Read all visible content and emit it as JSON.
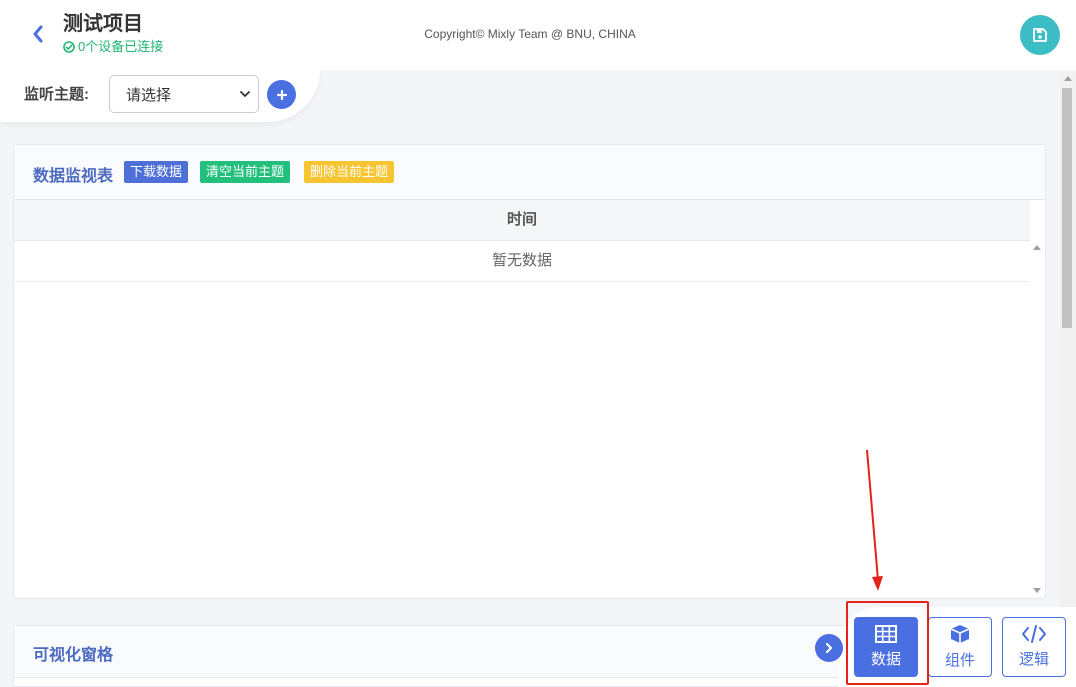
{
  "header": {
    "title": "测试项目",
    "status": "0个设备已连接",
    "copyright": "Copyright© Mixly Team @ BNU, CHINA"
  },
  "topic": {
    "label": "监听主题:",
    "select_value": "请选择"
  },
  "monitor": {
    "title": "数据监视表",
    "actions": {
      "download": "下载数据",
      "clear": "清空当前主题",
      "delete": "删除当前主题"
    },
    "columns": [
      "时间"
    ],
    "empty_text": "暂无数据"
  },
  "grid": {
    "title": "可视化窗格"
  },
  "toolbar": {
    "data_label": "数据",
    "component_label": "组件",
    "logic_label": "逻辑",
    "active": "数据"
  },
  "icons": {
    "back": "chevron-left-icon",
    "status": "check-circle-icon",
    "save": "floppy-disk-icon",
    "add": "plus-icon",
    "toggle": "chevron-right-icon",
    "data": "table-grid-icon",
    "component": "cube-icon",
    "logic": "code-icon"
  },
  "colors": {
    "primary": "#4a6fe0",
    "success": "#22c07c",
    "warning": "#f7c432",
    "save": "#3cbcc4",
    "annotation": "#e3241b"
  }
}
